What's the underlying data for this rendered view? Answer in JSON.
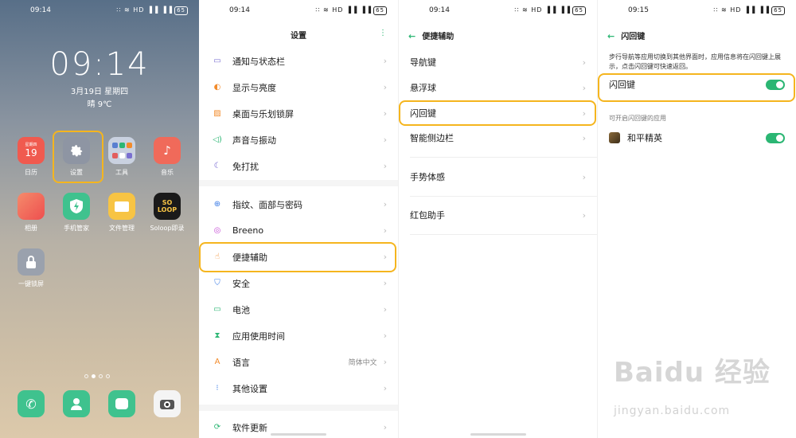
{
  "status": {
    "p1_time": "09:14",
    "p2_time": "09:14",
    "p3_time": "09:14",
    "p4_time": "09:15",
    "icons": "∷ ≋ HD ▐▐ ▐▐",
    "battery": "65"
  },
  "home": {
    "clock": "09:14",
    "date": "3月19日 星期四",
    "weather": "晴 9℃",
    "apps": [
      {
        "label": "日历",
        "icon": "calendar-icon",
        "color": "#f05a4f"
      },
      {
        "label": "设置",
        "icon": "gear-icon",
        "color": "#8e95a3"
      },
      {
        "label": "工具",
        "icon": "folder-icon",
        "color": "#c9d1e0"
      },
      {
        "label": "音乐",
        "icon": "music-icon",
        "color": "#f06a5a"
      },
      {
        "label": "相册",
        "icon": "gallery-icon",
        "color": "#f26d55"
      },
      {
        "label": "手机管家",
        "icon": "shield-icon",
        "color": "#3fc28e"
      },
      {
        "label": "文件管理",
        "icon": "folder-icon",
        "color": "#f7c444"
      },
      {
        "label": "Soloop即录",
        "icon": "soloop-icon",
        "color": "#1a1a1a"
      },
      {
        "label": "一键锁屏",
        "icon": "lock-icon",
        "color": "#9aa1ad"
      }
    ],
    "calendar_badge": "星期四",
    "calendar_day": "19",
    "soloop_text": "SO LOOP"
  },
  "settings": {
    "title": "设置",
    "group1": [
      {
        "label": "通知与状态栏",
        "icon": "notification-icon",
        "color": "#7a6fd0"
      },
      {
        "label": "显示与亮度",
        "icon": "brightness-icon",
        "color": "#f28b2b"
      },
      {
        "label": "桌面与乐划锁屏",
        "icon": "wallpaper-icon",
        "color": "#f28b2b"
      },
      {
        "label": "声音与振动",
        "icon": "sound-icon",
        "color": "#2bb673"
      },
      {
        "label": "免打扰",
        "icon": "moon-icon",
        "color": "#6a5acd"
      }
    ],
    "group2": [
      {
        "label": "指纹、面部与密码",
        "icon": "lock-icon",
        "color": "#3d7de6"
      },
      {
        "label": "Breeno",
        "icon": "breeno-icon",
        "color": "#c64fd6"
      },
      {
        "label": "便捷辅助",
        "icon": "hand-icon",
        "color": "#f28b2b"
      },
      {
        "label": "安全",
        "icon": "shield-icon",
        "color": "#3d7de6"
      },
      {
        "label": "电池",
        "icon": "battery-icon",
        "color": "#2bb673"
      },
      {
        "label": "应用使用时间",
        "icon": "hourglass-icon",
        "color": "#2bb673"
      },
      {
        "label": "语言",
        "icon": "language-icon",
        "color": "#f28b2b",
        "value": "简体中文"
      },
      {
        "label": "其他设置",
        "icon": "more-icon",
        "color": "#3d7de6"
      }
    ],
    "group3": [
      {
        "label": "软件更新",
        "icon": "update-icon",
        "color": "#2bb673"
      }
    ]
  },
  "assist": {
    "title": "便捷辅助",
    "items": [
      {
        "label": "导航键"
      },
      {
        "label": "悬浮球"
      },
      {
        "label": "闪回键"
      },
      {
        "label": "智能侧边栏"
      },
      {
        "label": "手势体感"
      },
      {
        "label": "红包助手"
      }
    ]
  },
  "flashback": {
    "title": "闪回键",
    "description": "步行导航等应用切换到其他界面时，应用信息将在闪回键上展示，点击闪回键可快速返回。",
    "toggle_label": "闪回键",
    "toggle_on": true,
    "apps_header": "可开启闪回键的应用",
    "apps": [
      {
        "label": "和平精英",
        "on": true
      }
    ]
  },
  "watermark": {
    "logo": "Baidu 经验",
    "url": "jingyan.baidu.com"
  }
}
